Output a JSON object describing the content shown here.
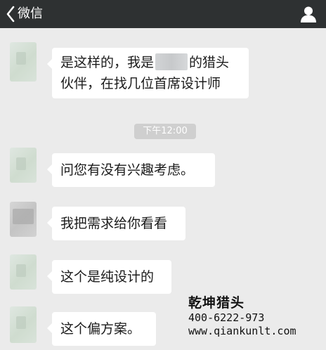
{
  "header": {
    "back_label": "微信",
    "back_icon": "chevron-left-icon",
    "profile_icon": "person-icon"
  },
  "colors": {
    "header_bg": "#2e3132",
    "chat_bg": "#ebebeb",
    "bubble_bg": "#ffffff",
    "timestamp_bg": "#cfcfcf"
  },
  "messages": [
    {
      "line1_before": "是这样的，我是",
      "line1_after": "的猎头",
      "line2": "伙伴，在找几位首席设计师"
    },
    {
      "text": "问您有没有兴趣考虑。"
    },
    {
      "text": "我把需求给你看看"
    },
    {
      "text": "这个是纯设计的"
    },
    {
      "text": "这个偏方案。"
    }
  ],
  "timestamp": "下午12:00",
  "watermark": {
    "brand": "乾坤猎头",
    "phone": "400-6222-973",
    "url": "www.qiankunlt.com"
  }
}
